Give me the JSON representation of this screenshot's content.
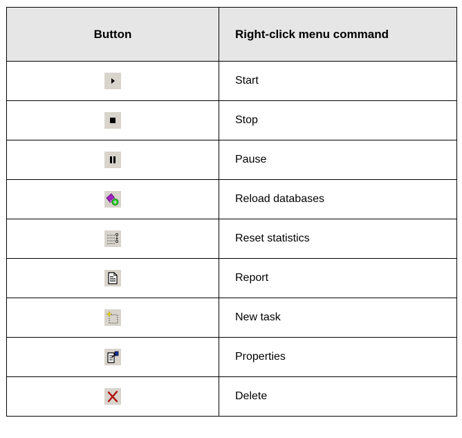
{
  "header": {
    "button_col": "Button",
    "command_col": "Right-click menu command"
  },
  "rows": [
    {
      "icon": "play-icon",
      "command": "Start"
    },
    {
      "icon": "stop-icon",
      "command": "Stop"
    },
    {
      "icon": "pause-icon",
      "command": "Pause"
    },
    {
      "icon": "reload-databases-icon",
      "command": "Reload databases"
    },
    {
      "icon": "reset-statistics-icon",
      "command": "Reset statistics"
    },
    {
      "icon": "report-icon",
      "command": "Report"
    },
    {
      "icon": "new-task-icon",
      "command": "New task"
    },
    {
      "icon": "properties-icon",
      "command": "Properties"
    },
    {
      "icon": "delete-icon",
      "command": "Delete"
    }
  ],
  "colors": {
    "header_bg": "#e6e6e6",
    "icon_bg": "#d8d4cc",
    "delete_red": "#b01010",
    "reload_magenta": "#a020c0",
    "reload_green": "#30d030"
  }
}
